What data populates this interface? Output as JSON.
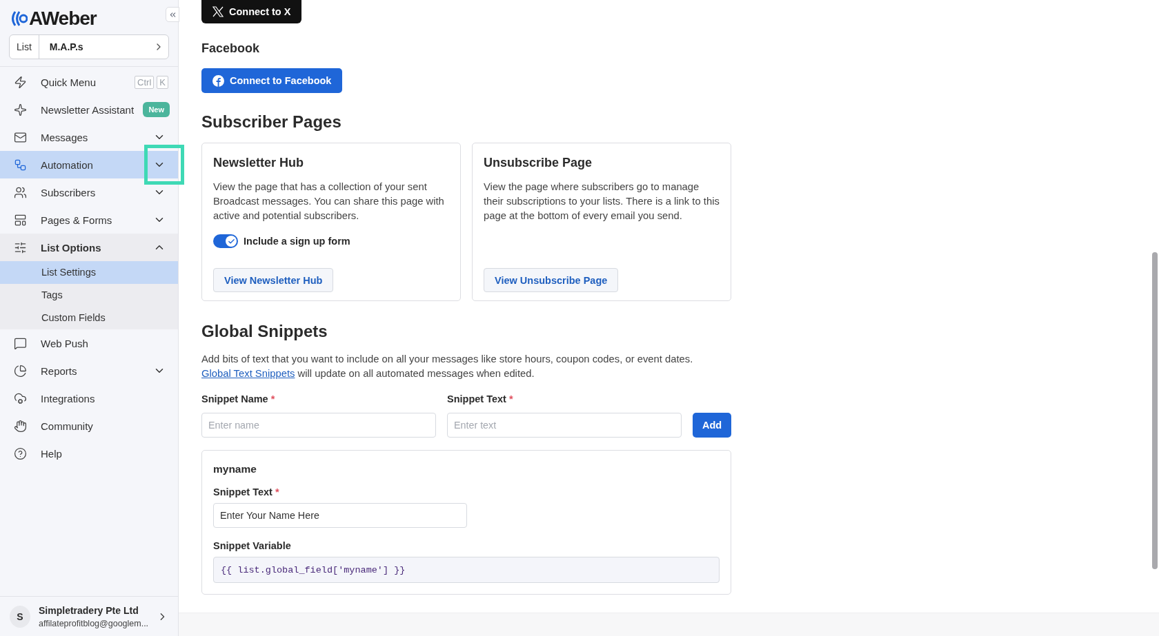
{
  "sidebar": {
    "logo": "AWeber",
    "list_selector": {
      "label": "List",
      "value": "M.A.P.s"
    },
    "nav_items": [
      {
        "kind": "shortcut",
        "label": "Quick Menu",
        "keys": [
          "Ctrl",
          "K"
        ],
        "selected": false
      },
      {
        "kind": "badge",
        "label": "Newsletter Assistant",
        "badge": "New",
        "selected": false
      },
      {
        "kind": "expandable",
        "label": "Messages",
        "expanded": false,
        "selected": false,
        "highlighted": false
      },
      {
        "kind": "expandable",
        "label": "Automation",
        "expanded": false,
        "selected": true,
        "highlighted": true
      },
      {
        "kind": "expandable",
        "label": "Subscribers",
        "expanded": false,
        "selected": false,
        "highlighted": false
      },
      {
        "kind": "expandable",
        "label": "Pages & Forms",
        "expanded": false,
        "selected": false,
        "highlighted": false
      },
      {
        "kind": "expandable",
        "label": "List Options",
        "expanded": true,
        "selected": false,
        "highlighted": false,
        "children": [
          {
            "label": "List Settings",
            "selected": true
          },
          {
            "label": "Tags",
            "selected": false
          },
          {
            "label": "Custom Fields",
            "selected": false
          }
        ]
      },
      {
        "kind": "plain",
        "label": "Web Push",
        "selected": false
      },
      {
        "kind": "expandable",
        "label": "Reports",
        "expanded": false,
        "selected": false,
        "highlighted": false
      },
      {
        "kind": "plain",
        "label": "Integrations",
        "selected": false
      },
      {
        "kind": "plain",
        "label": "Community",
        "selected": false
      },
      {
        "kind": "plain",
        "label": "Help",
        "selected": false
      }
    ],
    "account": {
      "initial": "S",
      "name": "Simpletradery Pte Ltd",
      "email": "affilateprofitblog@googlem..."
    }
  },
  "social": {
    "x_button": "Connect to X",
    "facebook_heading": "Facebook",
    "facebook_button": "Connect to Facebook"
  },
  "subscriber_pages": {
    "heading": "Subscriber Pages",
    "cards": [
      {
        "title": "Newsletter Hub",
        "description": "View the page that has a collection of your sent Broadcast messages. You can share this page with active and potential subscribers.",
        "toggle": {
          "label": "Include a sign up form",
          "on": true
        },
        "button": "View Newsletter Hub"
      },
      {
        "title": "Unsubscribe Page",
        "description": "View the page where subscribers go to manage their subscriptions to your lists. There is a link to this page at the bottom of every email you send.",
        "button": "View Unsubscribe Page"
      }
    ]
  },
  "global_snippets": {
    "heading": "Global Snippets",
    "description_before": "Add bits of text that you want to include on all your messages like store hours, coupon codes, or event dates.",
    "link": "Global Text Snippets",
    "description_after": "will update on all automated messages when edited.",
    "fields": [
      {
        "label": "Snippet Name",
        "required_mark": "*",
        "placeholder": "Enter name"
      },
      {
        "label": "Snippet Text",
        "required_mark": "*",
        "placeholder": "Enter text"
      }
    ],
    "add_button": "Add",
    "snippets": [
      {
        "name": "myname",
        "text_label": "Snippet Text",
        "required_mark": "*",
        "text_value": "Enter Your Name Here",
        "variable_label": "Snippet Variable",
        "variable": "{{ list.global_field['myname'] }}"
      }
    ]
  }
}
